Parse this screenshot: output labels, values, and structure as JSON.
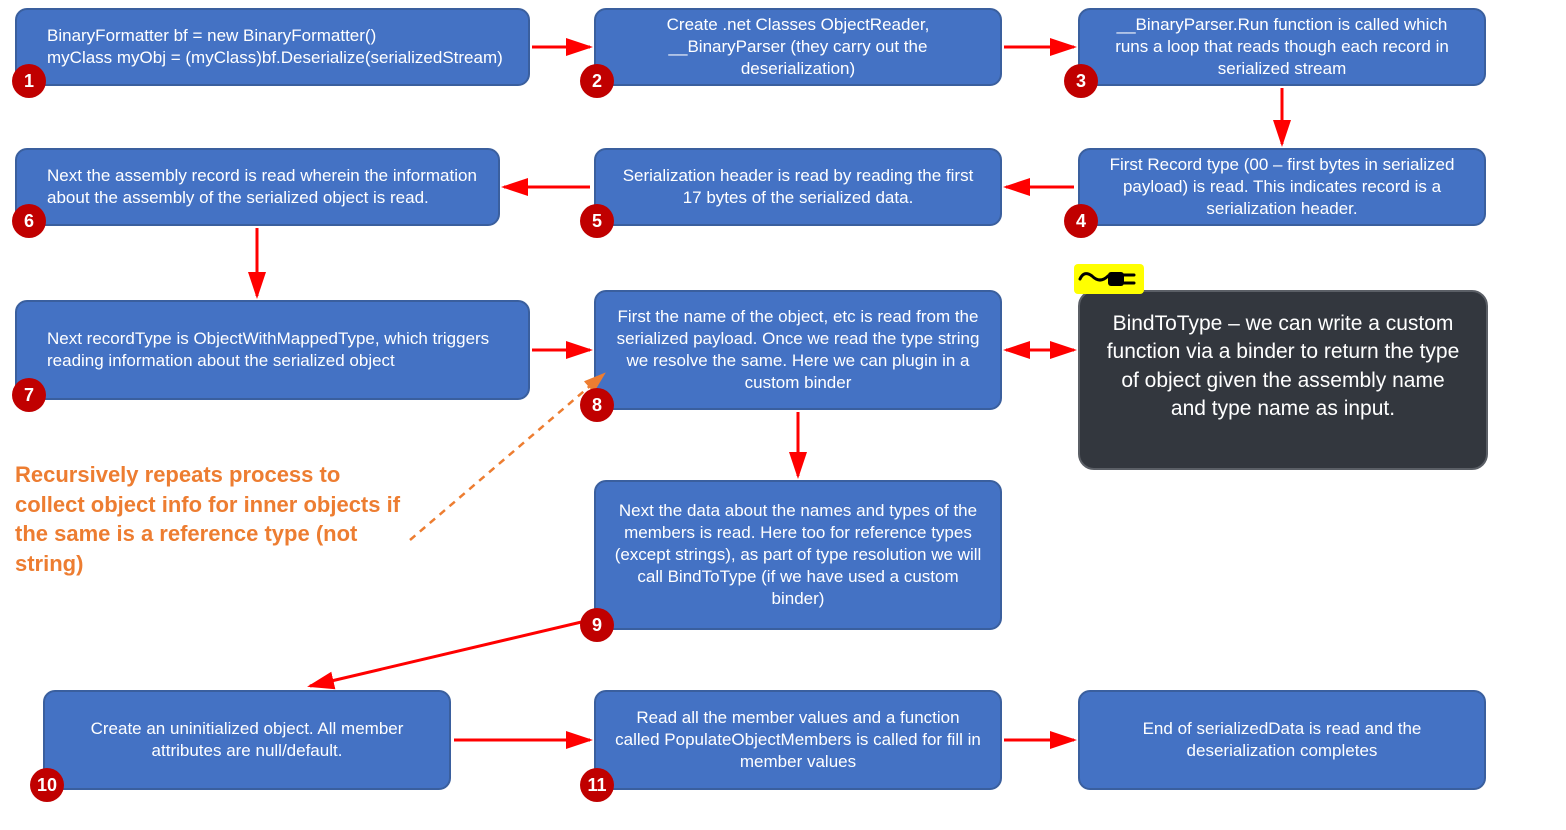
{
  "nodes": {
    "n1": {
      "text": "BinaryFormatter bf = new BinaryFormatter()\nmyClass myObj =  (myClass)bf.Deserialize(serializedStream)"
    },
    "n2": {
      "text": "Create .net Classes ObjectReader, __BinaryParser (they carry out the deserialization)"
    },
    "n3": {
      "text": "__BinaryParser.Run function is called which runs a loop that reads though each record in serialized stream"
    },
    "n4": {
      "text": "First Record type (00 – first bytes in serialized payload) is read. This indicates record is a serialization header."
    },
    "n5": {
      "text": "Serialization header is read by reading the first 17 bytes of the serialized data."
    },
    "n6": {
      "text": "Next the assembly record is read wherein the information about the assembly of the serialized object is read."
    },
    "n7": {
      "text": "Next recordType is ObjectWithMappedType, which triggers reading information about the serialized object"
    },
    "n8": {
      "text": "First the name of the object, etc is read from the serialized payload. Once we read the type string we resolve the same. Here we can plugin in a custom binder"
    },
    "n9": {
      "text": "Next the data about the names and types of the members is read. Here too for reference types (except strings), as part of type resolution we will call BindToType (if we have used a custom binder)"
    },
    "n10": {
      "text": "Create an uninitialized object. All member attributes are null/default."
    },
    "n11": {
      "text": "Read all the member values and a function called PopulateObjectMembers is called for fill in member values"
    },
    "n12": {
      "text": "End of serializedData is read and the deserialization completes"
    }
  },
  "dark": {
    "text": "BindToType – we can write a custom function via a binder to return the type of object given the assembly name and type name as input."
  },
  "annotation": {
    "text": "Recursively repeats process to collect object info for inner objects if the same is a reference type (not string)"
  },
  "badges": {
    "b1": "1",
    "b2": "2",
    "b3": "3",
    "b4": "4",
    "b5": "5",
    "b6": "6",
    "b7": "7",
    "b8": "8",
    "b9": "9",
    "b10": "10",
    "b11": "11"
  },
  "colors": {
    "node_bg": "#4472c4",
    "node_border": "#3a5f9e",
    "badge_bg": "#c00000",
    "arrow": "#ff0000",
    "arrow_dashed": "#ed7d31",
    "annotation": "#ed7d31",
    "dark_bg": "#33373e",
    "plug_bg": "#ffff00"
  }
}
